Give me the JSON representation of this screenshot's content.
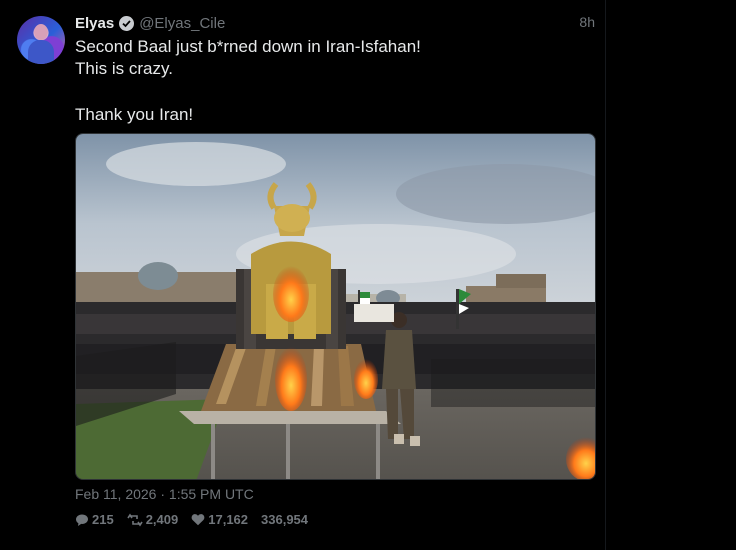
{
  "tweet": {
    "author_name": "Elyas",
    "author_handle": "@Elyas_Cile",
    "time_ago": "8h",
    "lines": [
      "Second Baal just b*rned down in Iran-Isfahan!",
      "This is crazy.",
      "Thank you Iran!"
    ],
    "timestamp": "Feb 11, 2026 · 1:55 PM UTC",
    "stats": {
      "replies": "215",
      "retweets": "2,409",
      "likes": "17,162",
      "views": "336,954"
    }
  },
  "icons": {
    "verified": "verified-badge-icon",
    "reply": "comment-bubble-icon",
    "retweet": "retweet-arrows-icon",
    "like": "heart-icon"
  },
  "colors": {
    "background": "#000000",
    "text": "#e7e9ea",
    "muted": "#71767b"
  }
}
